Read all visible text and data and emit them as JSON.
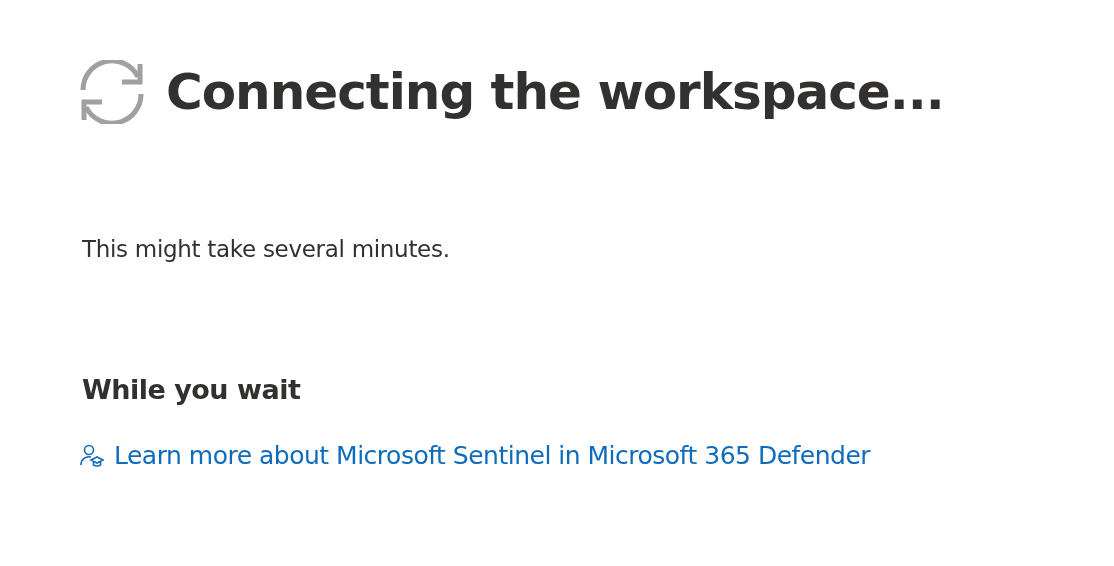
{
  "title": "Connecting the workspace...",
  "message": "This might take several minutes.",
  "section_heading": "While you wait",
  "links": [
    {
      "label": "Learn more about Microsoft Sentinel in Microsoft 365 Defender"
    }
  ]
}
